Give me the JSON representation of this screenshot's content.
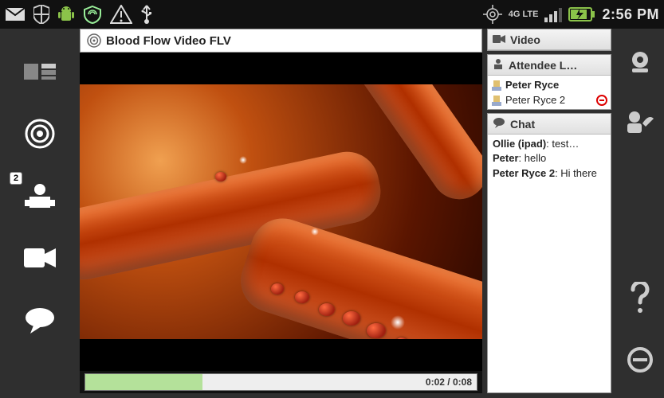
{
  "statusbar": {
    "time": "2:56 PM",
    "network_label": "4G LTE"
  },
  "leftnav": {
    "participants_badge": "2"
  },
  "main_panel": {
    "title": "Blood Flow Video FLV",
    "time_current": "0:02",
    "time_total": "0:08",
    "progress_pct": 30
  },
  "side": {
    "video": {
      "title": "Video"
    },
    "attendees": {
      "title": "Attendee L…",
      "items": [
        {
          "name": "Peter Ryce",
          "bold": true,
          "blocked": false
        },
        {
          "name": "Peter Ryce 2",
          "bold": false,
          "blocked": true
        }
      ]
    },
    "chat": {
      "title": "Chat",
      "messages": [
        {
          "from": "Ollie (ipad)",
          "text": "test…"
        },
        {
          "from": "Peter",
          "text": "hello"
        },
        {
          "from": "Peter Ryce 2",
          "text": "Hi there"
        }
      ]
    }
  }
}
